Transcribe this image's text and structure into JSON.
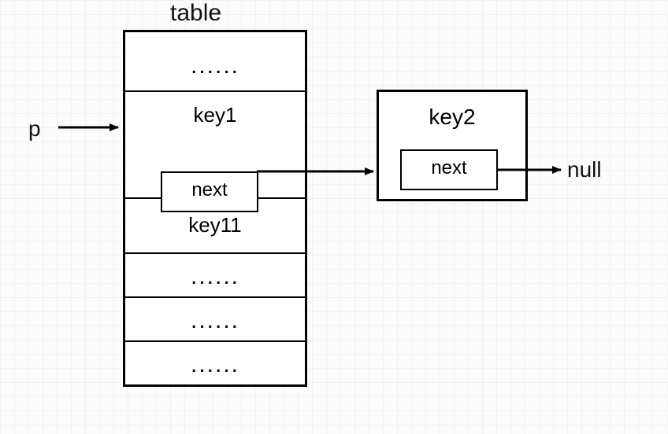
{
  "title_table": "table",
  "pointer_label": "p",
  "null_label": "null",
  "rows": {
    "r0": "......",
    "r1": "key1",
    "r1_next": "next",
    "r2": "key11",
    "r3": "......",
    "r4": "......",
    "r5": "......"
  },
  "node2": {
    "label": "key2",
    "next": "next"
  }
}
